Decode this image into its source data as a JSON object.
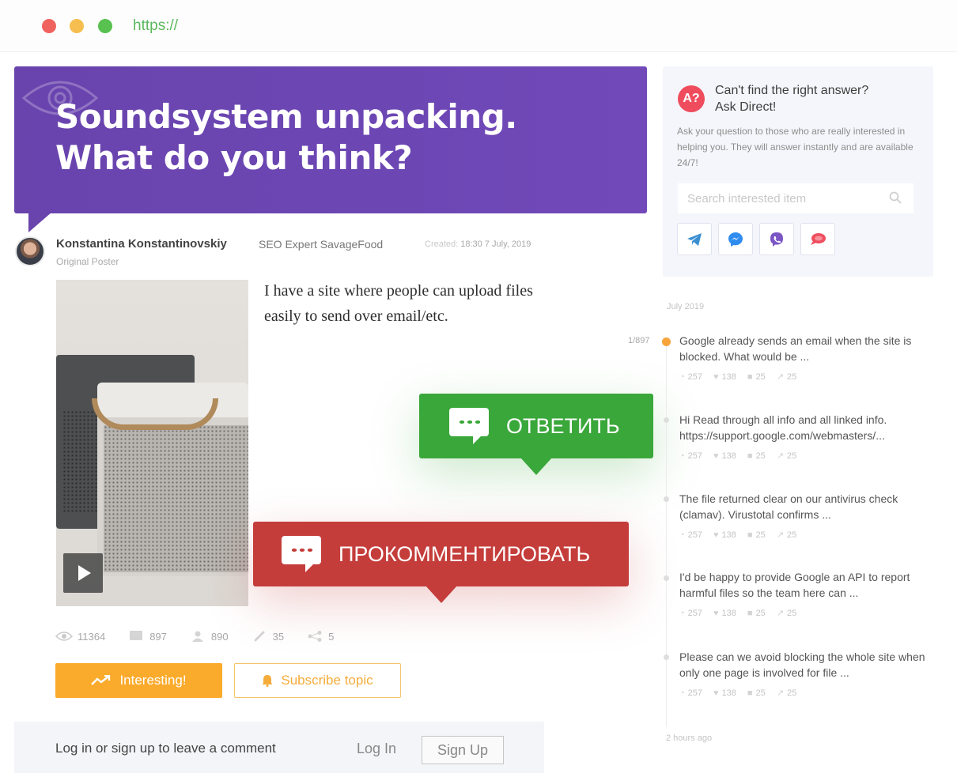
{
  "browser": {
    "url": "https://"
  },
  "post": {
    "title_line1": "Soundsystem unpacking.",
    "title_line2": "What do you think?",
    "author_name": "Konstantina Konstantinovskiy",
    "author_role": "SEO Expert SavageFood",
    "created_label": "Created:",
    "created_value": "18:30  7 July, 2019",
    "author_badge": "Original Poster",
    "body": "I have a site where people can upload files easily to send over email/etc.",
    "stats": [
      {
        "icon": "eye-icon",
        "value": "11364"
      },
      {
        "icon": "comment-icon",
        "value": "897"
      },
      {
        "icon": "user-icon",
        "value": "890"
      },
      {
        "icon": "link-icon",
        "value": "35"
      },
      {
        "icon": "share-icon",
        "value": "5"
      }
    ],
    "interesting_label": "Interesting!",
    "subscribe_label": "Subscribe topic"
  },
  "comment_bar": {
    "prompt": "Log in or sign up to leave a comment",
    "login": "Log In",
    "signup": "Sign Up"
  },
  "callouts": {
    "reply": "ОТВЕТИТЬ",
    "comment": "ПРОКОММЕНТИРОВАТЬ",
    "reply_color": "#3aa73a",
    "comment_color": "#c43d3b"
  },
  "direct": {
    "badge": "A?",
    "title_line1": "Can't find the right answer?",
    "title_line2": "Ask Direct!",
    "description": "Ask your question to those who are really interested in helping you. They will answer instantly and are available 24/7!",
    "search_placeholder": "Search interested item",
    "channels": [
      "telegram-icon",
      "messenger-icon",
      "viber-icon",
      "chat-icon"
    ]
  },
  "timeline": {
    "month": "July 2019",
    "counter": "1/897",
    "items": [
      {
        "text": "Google already sends an email when the site is blocked. What would be ...",
        "views": "257",
        "likes": "138",
        "comments": "25",
        "shares": "25"
      },
      {
        "text": "Hi Read through all info and all linked info. https://support.google.com/webmasters/...",
        "views": "257",
        "likes": "138",
        "comments": "25",
        "shares": "25"
      },
      {
        "text": "The file returned clear on our antivirus check (clamav). Virustotal confirms ...",
        "views": "257",
        "likes": "138",
        "comments": "25",
        "shares": "25"
      },
      {
        "text": "I'd be happy to provide Google an API to report harmful files so the team here can ...",
        "views": "257",
        "likes": "138",
        "comments": "25",
        "shares": "25"
      },
      {
        "text": "Please can we avoid blocking the whole site when only one page is involved for file ...",
        "views": "257",
        "likes": "138",
        "comments": "25",
        "shares": "25"
      }
    ],
    "time_ago": "2 hours ago"
  },
  "colors": {
    "accent_purple": "#6a44ad",
    "accent_orange": "#fbab2c",
    "timeline_active": "#f7a53b"
  }
}
